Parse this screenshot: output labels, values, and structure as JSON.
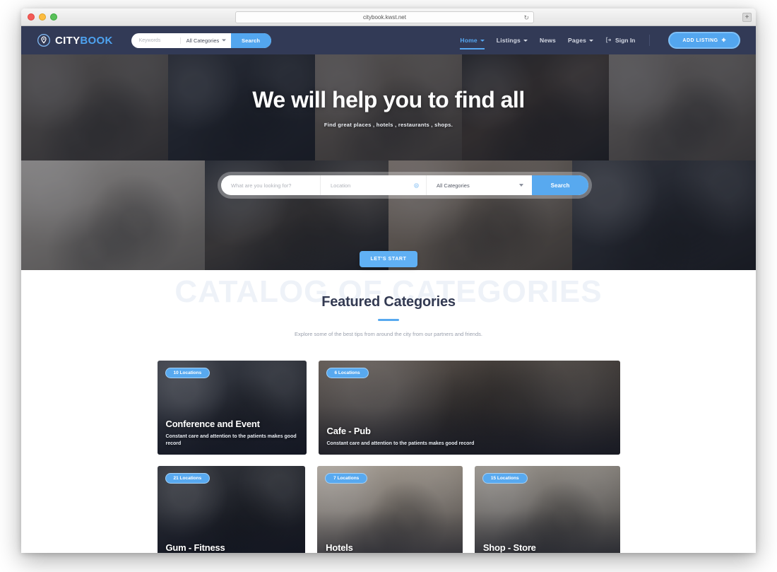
{
  "browser": {
    "url": "citybook.kwst.net",
    "reload_icon": "reload-icon",
    "traffic_lights": [
      "close",
      "minimize",
      "maximize"
    ],
    "toolbar_right_icon": "expand-icon"
  },
  "header": {
    "logo": {
      "primary": "CITY",
      "secondary": "BOOK",
      "icon": "map-pin-icon"
    },
    "search": {
      "keywords_placeholder": "Keywords",
      "category_value": "All Categories",
      "button_label": "Search"
    },
    "nav": [
      {
        "label": "Home",
        "has_caret": true,
        "active": true
      },
      {
        "label": "Listings",
        "has_caret": true,
        "active": false
      },
      {
        "label": "News",
        "has_caret": false,
        "active": false
      },
      {
        "label": "Pages",
        "has_caret": true,
        "active": false
      }
    ],
    "sign_in": {
      "label": "Sign In",
      "icon": "sign-in-icon"
    },
    "add_listing": {
      "label": "ADD LISTING",
      "icon": "plus-icon"
    }
  },
  "hero": {
    "title": "We will help you to find all",
    "subtitle": "Find great places , hotels , restaurants , shops.",
    "tiles": [
      "shopping-couple",
      "gym-training",
      "business-meeting",
      "pizza-oven",
      "smiling-couple"
    ]
  },
  "search_bar": {
    "keyword_placeholder": "What are you looking for?",
    "location_placeholder": "Location",
    "location_icon": "geolocate-icon",
    "category_value": "All Categories",
    "button_label": "Search",
    "cta_label": "LET'S START",
    "tiles": [
      "hotel-bedroom",
      "workspace-desk",
      "cafe-couple",
      "restaurant-bar"
    ]
  },
  "featured": {
    "watermark": "CATALOG OF CATEGORIES",
    "title": "Featured Categories",
    "subtitle": "Explore some of the best tips from around the city from our partners and friends.",
    "cards": [
      {
        "badge": "10 Locations",
        "title": "Conference and Event",
        "desc": "Constant care and attention to the patients makes good record",
        "size": "w1",
        "photo": "p7"
      },
      {
        "badge": "6 Locations",
        "title": "Cafe - Pub",
        "desc": "Constant care and attention to the patients makes good record",
        "size": "w2",
        "photo": "p11"
      },
      {
        "badge": "21 Locations",
        "title": "Gum - Fitness",
        "desc": "",
        "size": "w1",
        "photo": "p12"
      },
      {
        "badge": "7 Locations",
        "title": "Hotels",
        "desc": "",
        "size": "w3",
        "photo": "p13"
      },
      {
        "badge": "15 Locations",
        "title": "Shop - Store",
        "desc": "",
        "size": "w3",
        "photo": "p14"
      }
    ]
  },
  "accent_colors": {
    "brand_blue": "#58a9ef",
    "header_navy": "#323a56",
    "title_dark": "#333a52",
    "watermark_grey": "#eef2f8"
  }
}
